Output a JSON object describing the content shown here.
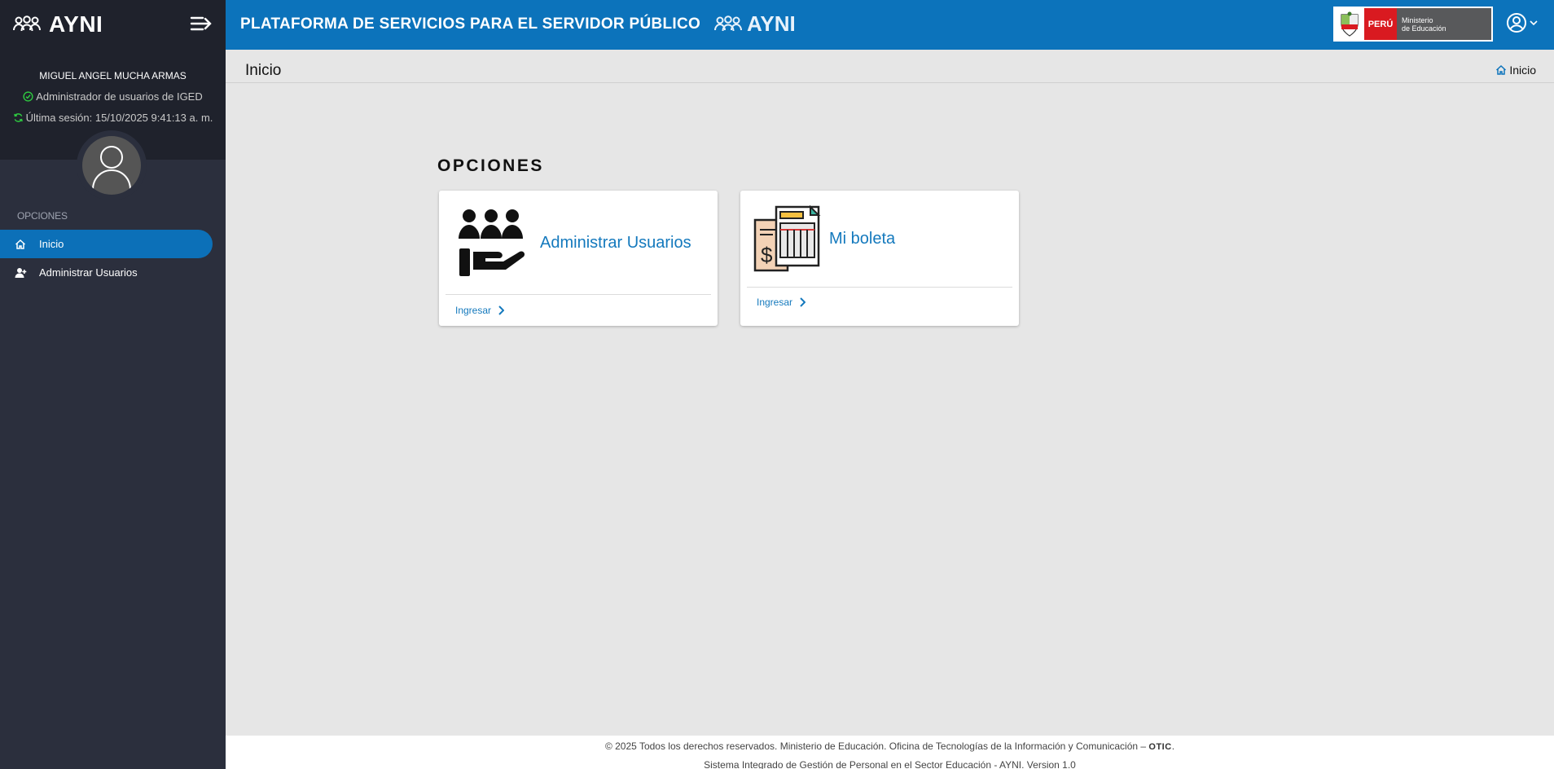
{
  "sidebar": {
    "brand": "AYNI",
    "user_name": "MIGUEL ANGEL MUCHA ARMAS",
    "role": "Administrador de usuarios de IGED",
    "last_session": "Última sesión: 15/10/2025 9:41:13 a. m.",
    "section_label": "OPCIONES",
    "items": [
      {
        "label": "Inicio",
        "icon": "home-icon",
        "active": true
      },
      {
        "label": "Administrar Usuarios",
        "icon": "user-plus-icon",
        "active": false
      }
    ]
  },
  "header": {
    "title": "PLATAFORMA DE SERVICIOS PARA EL SERVIDOR PÚBLICO",
    "brand": "AYNI",
    "institution_peru": "PERÚ",
    "institution_line1": "Ministerio",
    "institution_line2": "de Educación"
  },
  "page": {
    "title": "Inicio",
    "breadcrumb": "Inicio"
  },
  "main": {
    "section_title": "OPCIONES",
    "cards": [
      {
        "title": "Administrar Usuarios",
        "action": "Ingresar",
        "icon": "users-hand-icon"
      },
      {
        "title": "Mi boleta",
        "action": "Ingresar",
        "icon": "payslip-icon"
      }
    ]
  },
  "footer": {
    "line1": "© 2025 Todos los derechos reservados. Ministerio de Educación. Oficina de Tecnologías de la Información y Comunicación –",
    "otic": "OTIC",
    "line2": "Sistema Integrado de Gestión de Personal en el Sector Educación - AYNI. Version 1.0"
  },
  "colors": {
    "header_blue": "#0c73bb",
    "sidebar_dark": "#2b2f3d",
    "active_item": "#0c70b8",
    "link_blue": "#1479bd"
  }
}
